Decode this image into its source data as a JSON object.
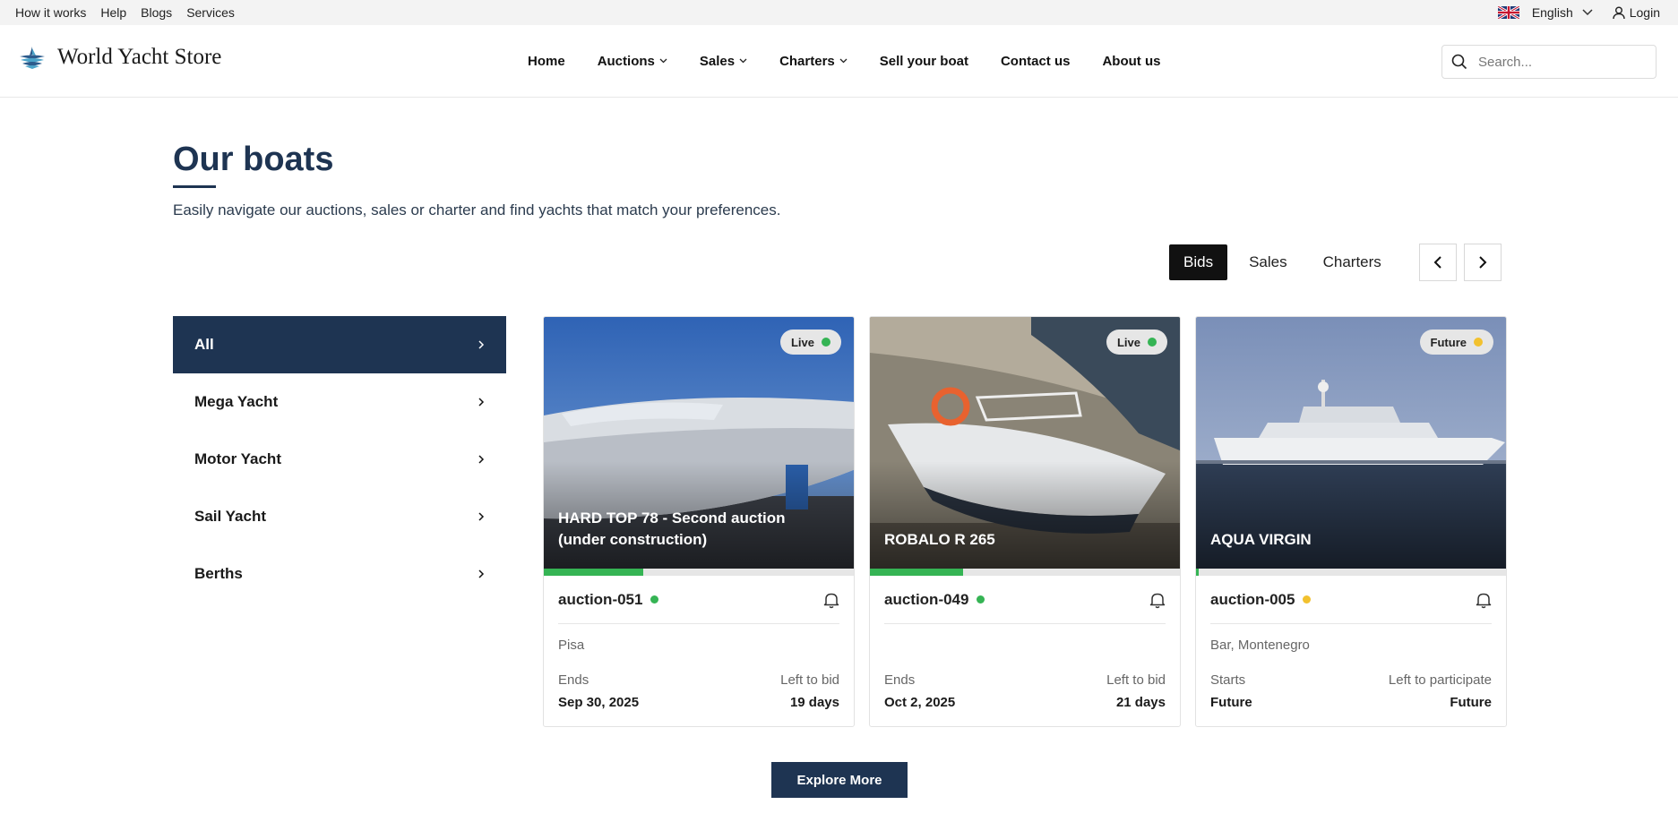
{
  "topbar": {
    "links": [
      "How it works",
      "Help",
      "Blogs",
      "Services"
    ],
    "language": "English",
    "login": "Login"
  },
  "header": {
    "brand": "World Yacht Store",
    "nav": [
      "Home",
      "Auctions",
      "Sales",
      "Charters",
      "Sell your boat",
      "Contact us",
      "About us"
    ],
    "search_placeholder": "Search..."
  },
  "section": {
    "title": "Our boats",
    "subtitle": "Easily navigate our auctions, sales or charter and find yachts that match your preferences.",
    "tabs": [
      "Bids",
      "Sales",
      "Charters"
    ],
    "active_tab": "Bids"
  },
  "categories": [
    "All",
    "Mega Yacht",
    "Motor Yacht",
    "Sail Yacht",
    "Berths"
  ],
  "cards": [
    {
      "name": "HARD TOP 78 - Second auction (under construction)",
      "status": "Live",
      "status_color": "#35b454",
      "progress": 0.32,
      "id": "auction-051",
      "location": "Pisa",
      "left_label": "Ends",
      "left_value": "Sep 30, 2025",
      "right_label": "Left to bid",
      "right_value": "19 days"
    },
    {
      "name": "ROBALO R 265",
      "status": "Live",
      "status_color": "#35b454",
      "progress": 0.3,
      "id": "auction-049",
      "location": "",
      "left_label": "Ends",
      "left_value": "Oct 2, 2025",
      "right_label": "Left to bid",
      "right_value": "21 days"
    },
    {
      "name": "AQUA VIRGIN",
      "status": "Future",
      "status_color": "#f2c12e",
      "progress": 0.01,
      "id": "auction-005",
      "location": "Bar, Montenegro",
      "left_label": "Starts",
      "left_value": "Future",
      "right_label": "Left to participate",
      "right_value": "Future"
    }
  ],
  "explore": "Explore More",
  "colors": {
    "primary": "#1e3452",
    "live": "#35b454",
    "future": "#f2c12e"
  }
}
